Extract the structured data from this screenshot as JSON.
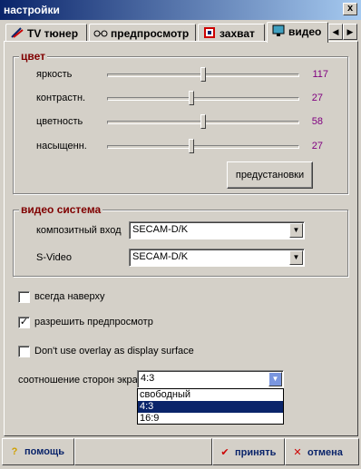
{
  "window": {
    "title": "настройки",
    "close_glyph": "x"
  },
  "tabs": [
    {
      "label": "TV тюнер",
      "icon": "tv-tuner-icon"
    },
    {
      "label": "предпросмотр",
      "icon": "glasses-icon"
    },
    {
      "label": "захват",
      "icon": "film-icon"
    },
    {
      "label": "видео",
      "icon": "monitor-icon",
      "active": true
    }
  ],
  "tab_scroll": {
    "left": "◀",
    "right": "▶"
  },
  "color_group": {
    "title": "цвет",
    "sliders": [
      {
        "label": "яркость",
        "value": "117",
        "fraction": 0.5
      },
      {
        "label": "контрастн.",
        "value": "27",
        "fraction": 0.44
      },
      {
        "label": "цветность",
        "value": "58",
        "fraction": 0.5
      },
      {
        "label": "насыщенн.",
        "value": "27",
        "fraction": 0.44
      }
    ],
    "presets_label": "предустановки"
  },
  "video_system": {
    "title": "видео система",
    "composite_label": "композитный вход",
    "composite_value": "SECAM-D/K",
    "svideo_label": "S-Video",
    "svideo_value": "SECAM-D/K"
  },
  "options": {
    "always_on_top": {
      "label": "всегда наверху",
      "checked": false
    },
    "allow_preview": {
      "label": "разрешить предпросмотр",
      "checked": true
    },
    "no_overlay": {
      "label": "Don't use overlay as display surface",
      "checked": false
    }
  },
  "aspect_ratio": {
    "label": "соотношение сторон экра",
    "value": "4:3",
    "options": [
      "свободный",
      "4:3",
      "16:9"
    ],
    "selected_index": 1
  },
  "footer": {
    "help_label": "помощь",
    "accept_label": "принять",
    "cancel_label": "отмена"
  },
  "colors": {
    "accent": "#0a246a",
    "group_title": "#800000",
    "value_text": "#800080"
  }
}
